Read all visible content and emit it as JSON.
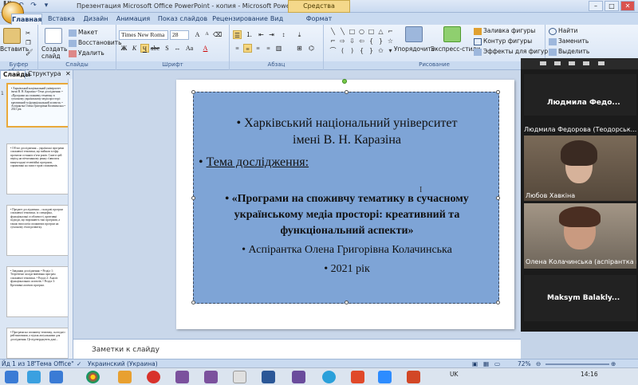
{
  "window": {
    "title": "Презентация Microsoft Office PowerPoint - копия - Microsoft PowerPoint",
    "context_tab": "Средства рисования"
  },
  "tabs": [
    "Главная",
    "Вставка",
    "Дизайн",
    "Анимация",
    "Показ слайдов",
    "Рецензирование",
    "Вид",
    "Формат"
  ],
  "ribbon": {
    "clipboard": {
      "paste": "Вставить",
      "label": "Буфер обмена"
    },
    "slides": {
      "new_slide": "Создать слайд",
      "layout": "Макет",
      "reset": "Восстановить",
      "delete": "Удалить",
      "label": "Слайды"
    },
    "font": {
      "name": "Times New Roma",
      "size": "28",
      "label": "Шрифт"
    },
    "paragraph": {
      "label": "Абзац"
    },
    "drawing": {
      "arrange": "Упорядочить",
      "quick_styles": "Экспресс-стили",
      "fill": "Заливка фигуры",
      "outline": "Контур фигуры",
      "effects": "Эффекты для фигур",
      "label": "Рисование"
    },
    "editing": {
      "find": "Найти",
      "replace": "Заменить",
      "select": "Выделить"
    }
  },
  "panel_tabs": [
    "Слайды",
    "Структура"
  ],
  "thumbnails": [
    {
      "num": "1",
      "text": "• Харківський національний університет імені В. Н. Каразіна • Тема дослідження: • «Програми на споживчу тематику в сучасному українському медіа просторі: креативний та функціональний аспекти» • Аспірантка Олена Григорівна Колачинська • 2021 рік"
    },
    {
      "num": "",
      "text": "• Об'єкт дослідження – українські програми споживчої тематики, що вийшли в ефір протягом останніх п'яти років. Саме в цей період на вітчизняному ринку з'явилися вищезгадані телевізійні програми, спрямовані на захист прав споживачів."
    },
    {
      "num": "",
      "text": "• Предмет дослідження – складові програм споживчої тематики, їх специфіка, функціональні особливості, креативні підходи, що вирізняють такі програми, а також типологія споживчих програм на сучасному етапі розвитку."
    },
    {
      "num": "",
      "text": "• Завдання дослідження: • Розділ 1: Теоретичні засади вивчення програм споживчої тематики. • Розділ 2: Аналіз функціональних аспектів. • Розділ 3: Креативні аспекти програм."
    },
    {
      "num": "",
      "text": "• Програми на споживчу тематику, сьогодні є рейтинговими, а відтак актуальними для дослідження. Це підтверджують дані..."
    }
  ],
  "slide": {
    "bullets": [
      "Харківський національний університет імені В. Н. Каразіна",
      "Тема дослідження:",
      "«Програми на споживчу тематику в сучасному українському медіа просторі: креативний та функціональний аспекти»",
      "Аспірантка Олена Григорівна Колачинська",
      "2021 рік"
    ],
    "bullet_char": "•"
  },
  "notes_placeholder": "Заметки к слайду",
  "status": {
    "slide_info": "Йд 1 из 18",
    "theme": "\"Тема Office\"",
    "language": "Украинский (Украина)",
    "zoom": "72%"
  },
  "taskbar": {
    "lang": "UK",
    "time": "14:16"
  },
  "participants": [
    {
      "name": "Людмила Федо...",
      "kind": "name-only"
    },
    {
      "name": "Людмила Федорова (Теодорськ...",
      "kind": "caption"
    },
    {
      "name": "Любов Хавкіна",
      "kind": "video"
    },
    {
      "name": "Олена Колачинська (аспірантка к...",
      "kind": "video"
    },
    {
      "name": "Maksym Balakly...",
      "kind": "name-only"
    }
  ]
}
